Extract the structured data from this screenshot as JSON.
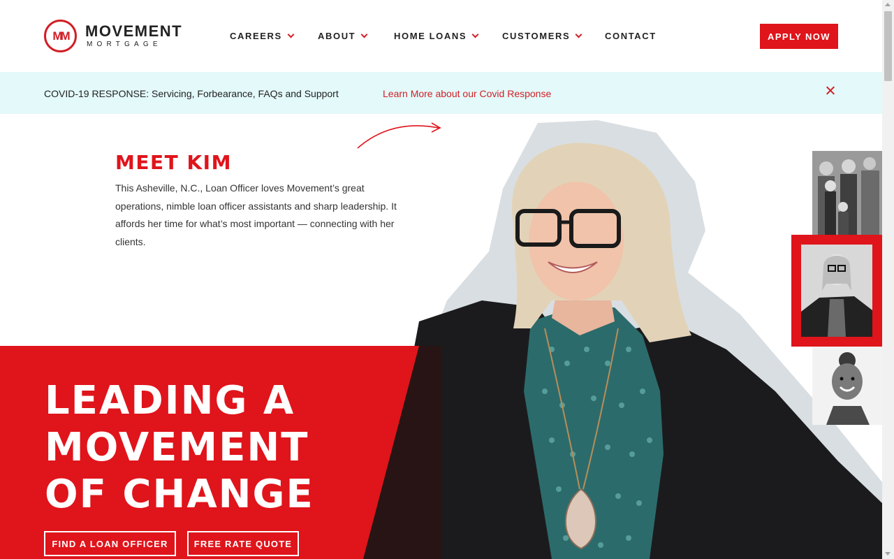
{
  "brand": {
    "logo_mark": "MM",
    "name": "MOVEMENT",
    "sub": "MORTGAGE",
    "accent_color": "#e0141b"
  },
  "nav": {
    "items": [
      {
        "label": "CAREERS",
        "has_dropdown": true
      },
      {
        "label": "ABOUT",
        "has_dropdown": true
      },
      {
        "label": "HOME LOANS",
        "has_dropdown": true
      },
      {
        "label": "CUSTOMERS",
        "has_dropdown": true
      },
      {
        "label": "CONTACT",
        "has_dropdown": false
      }
    ],
    "apply_label": "APPLY NOW"
  },
  "banner": {
    "text": "COVID-19 RESPONSE: Servicing, Forbearance, FAQs and Support",
    "link": "Learn More about our Covid Response",
    "background": "#e3f9fa"
  },
  "feature": {
    "title": "MEET KIM",
    "body": "This Asheville, N.C., Loan Officer loves Movement’s great operations, nimble loan officer assistants and sharp leadership. It affords her time for what’s most important — connecting with her clients."
  },
  "hero": {
    "headline": [
      "LEADING A",
      "MOVEMENT",
      "OF CHANGE"
    ],
    "cta_primary": "FIND A LOAN OFFICER",
    "cta_secondary": "FREE RATE QUOTE"
  },
  "thumbnails": [
    {
      "icon": "family-photo-thumbnail"
    },
    {
      "icon": "kim-photo-thumbnail",
      "selected": true
    },
    {
      "icon": "child-photo-thumbnail"
    }
  ]
}
